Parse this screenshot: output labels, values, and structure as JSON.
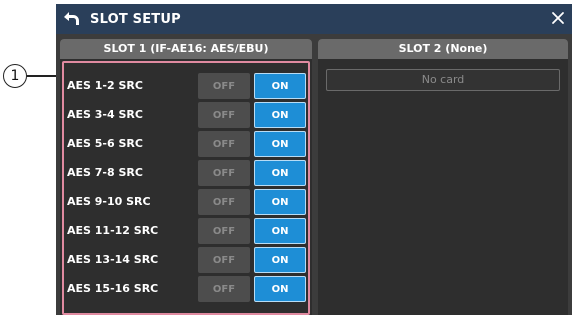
{
  "callout": {
    "number": "1"
  },
  "window": {
    "title": "SLOT SETUP"
  },
  "slot1": {
    "header": "SLOT 1 (IF-AE16: AES/EBU)",
    "rows": [
      {
        "label": "AES 1-2 SRC",
        "off": "OFF",
        "on": "ON",
        "state": "on"
      },
      {
        "label": "AES 3-4 SRC",
        "off": "OFF",
        "on": "ON",
        "state": "on"
      },
      {
        "label": "AES 5-6 SRC",
        "off": "OFF",
        "on": "ON",
        "state": "on"
      },
      {
        "label": "AES 7-8 SRC",
        "off": "OFF",
        "on": "ON",
        "state": "on"
      },
      {
        "label": "AES 9-10 SRC",
        "off": "OFF",
        "on": "ON",
        "state": "on"
      },
      {
        "label": "AES 11-12 SRC",
        "off": "OFF",
        "on": "ON",
        "state": "on"
      },
      {
        "label": "AES 13-14 SRC",
        "off": "OFF",
        "on": "ON",
        "state": "on"
      },
      {
        "label": "AES 15-16 SRC",
        "off": "OFF",
        "on": "ON",
        "state": "on"
      }
    ]
  },
  "slot2": {
    "header": "SLOT 2 (None)",
    "status": "No card"
  },
  "colors": {
    "title_bar": "#2a3f5a",
    "on_button": "#1e8ed6",
    "highlight_border": "#e08aa0"
  }
}
